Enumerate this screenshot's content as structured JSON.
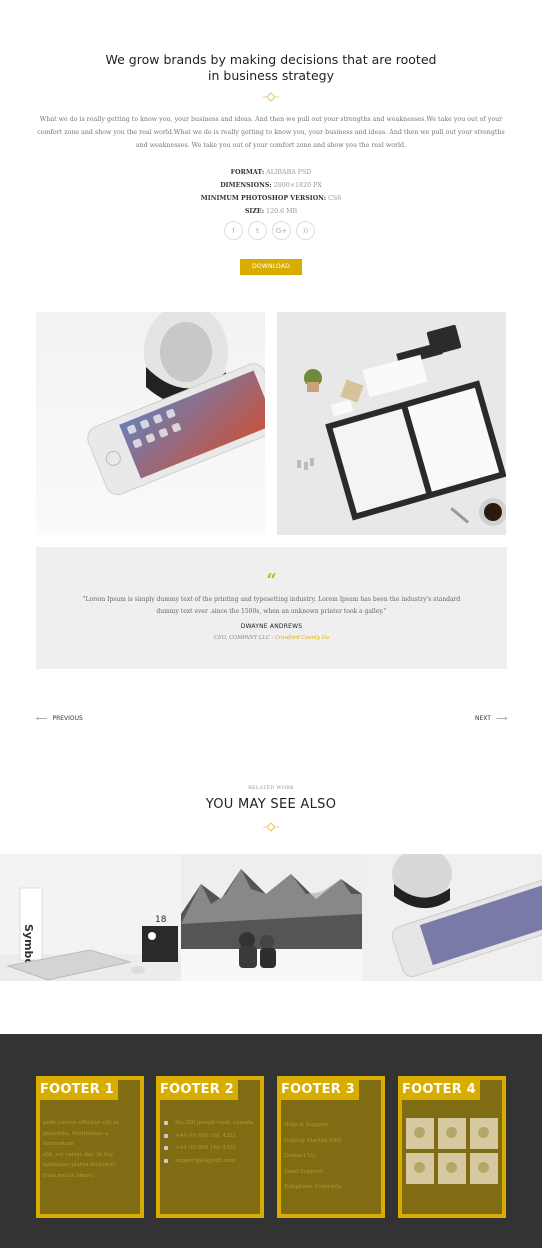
{
  "header": {
    "title_line1": "We grow brands by making decisions that are rooted",
    "title_line2": "in business strategy"
  },
  "intro": {
    "text": "What we do is really getting to know you, your business and ideas. And then we pull out your strengths and weaknesses.We take you out of your comfort zone and show you the real world.What we do is really getting to know you, your business and ideas. And then we pull out your strengths and weaknesses. We take you out of your comfort zone and show you the real world."
  },
  "specs": {
    "format_label": "FORMAT:",
    "format_value": "ALIBABA PSD",
    "dimensions_label": "DIMENSIONS:",
    "dimensions_value": "2800×1820 PX",
    "version_label": "MINIMUM PHOTOSHOP VERSION:",
    "version_value": "CS6",
    "size_label": "SIZE:",
    "size_value": "120.6 MB"
  },
  "social": {
    "facebook": "f",
    "twitter": "t",
    "googleplus": "G+",
    "rss": "))"
  },
  "download_label": "DOWNLOAD",
  "testimonial": {
    "text": "\"Lorem Ipsum is simply dummy text of the printing and typesetting industry. Lorem Ipsum has been the industry's standard dummy text ever .since the 1500s, when an unknown printer took a galley.\"",
    "name": "DWAYNE ANDREWS",
    "role": "CEO, COMPANY LLC -",
    "company": "Crawford County Ga"
  },
  "pagination": {
    "prev_label": "PREVIOUS",
    "next_label": "NEXT"
  },
  "related": {
    "subtitle": "RELATED WORK",
    "title": "YOU MAY SEE ALSO"
  },
  "footer": {
    "col1": {
      "title": "FOOTER 1",
      "lines": [
        "pede cursus efficitur elit at",
        "gilustrita. Vestibulum a fermentum",
        "elit, vel varius dui. In hac",
        "habitasse platea dictumst.",
        "Duis metus libero."
      ]
    },
    "col2": {
      "title": "FOOTER 2",
      "lines": [
        "No.200 joseph road, canada",
        "+44 (0) 800 161 4321",
        "+44 (0) 800 161 4321",
        "support@logistft.com"
      ]
    },
    "col3": {
      "title": "FOOTER 3",
      "lines": [
        "Help & Support",
        "Getting Started FAQ",
        "Contact Us",
        "Send Support",
        "Telephone Contracts"
      ]
    },
    "col4": {
      "title": "FOOTER 4"
    }
  },
  "colors": {
    "accent": "#d9ad00",
    "footer_bg": "#333333",
    "footer_col_bg": "#806c12",
    "testimonial_bg": "#efefef"
  }
}
